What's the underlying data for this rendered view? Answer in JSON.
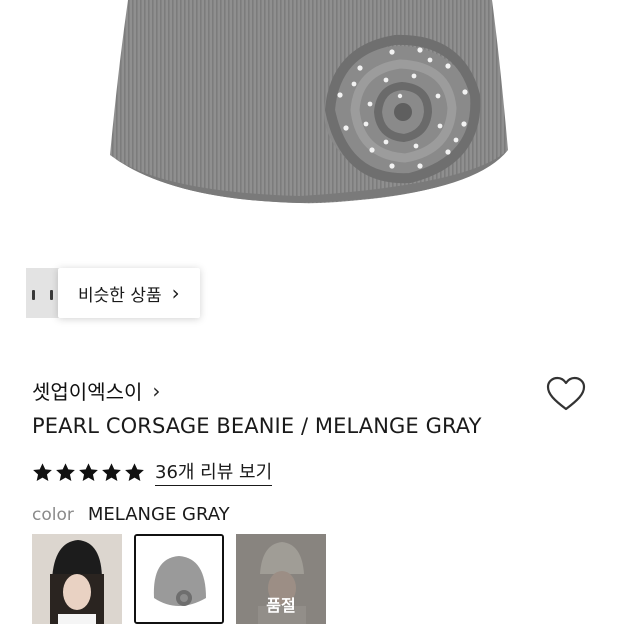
{
  "hero": {
    "image_icon": "beanie-product-photo",
    "colors": {
      "knit": "#8f8f8f",
      "knit_dark": "#7a7a7a",
      "pearl": "#f2f2f2"
    }
  },
  "similar": {
    "label": "비슷한 상품",
    "chevron": "›"
  },
  "product": {
    "brand": "셋업이엑스이",
    "brand_chevron": "›",
    "title": "PEARL CORSAGE BEANIE / MELANGE GRAY",
    "rating_stars": 5,
    "reviews_link": "36개 리뷰 보기",
    "color_label": "color",
    "color_value": "MELANGE GRAY",
    "wishlist_icon": "heart-outline-icon"
  },
  "options": [
    {
      "name": "black",
      "selected": false,
      "soldout": false
    },
    {
      "name": "melange-gray",
      "selected": true,
      "soldout": false
    },
    {
      "name": "ivory",
      "selected": false,
      "soldout": true,
      "soldout_label": "품절"
    }
  ]
}
